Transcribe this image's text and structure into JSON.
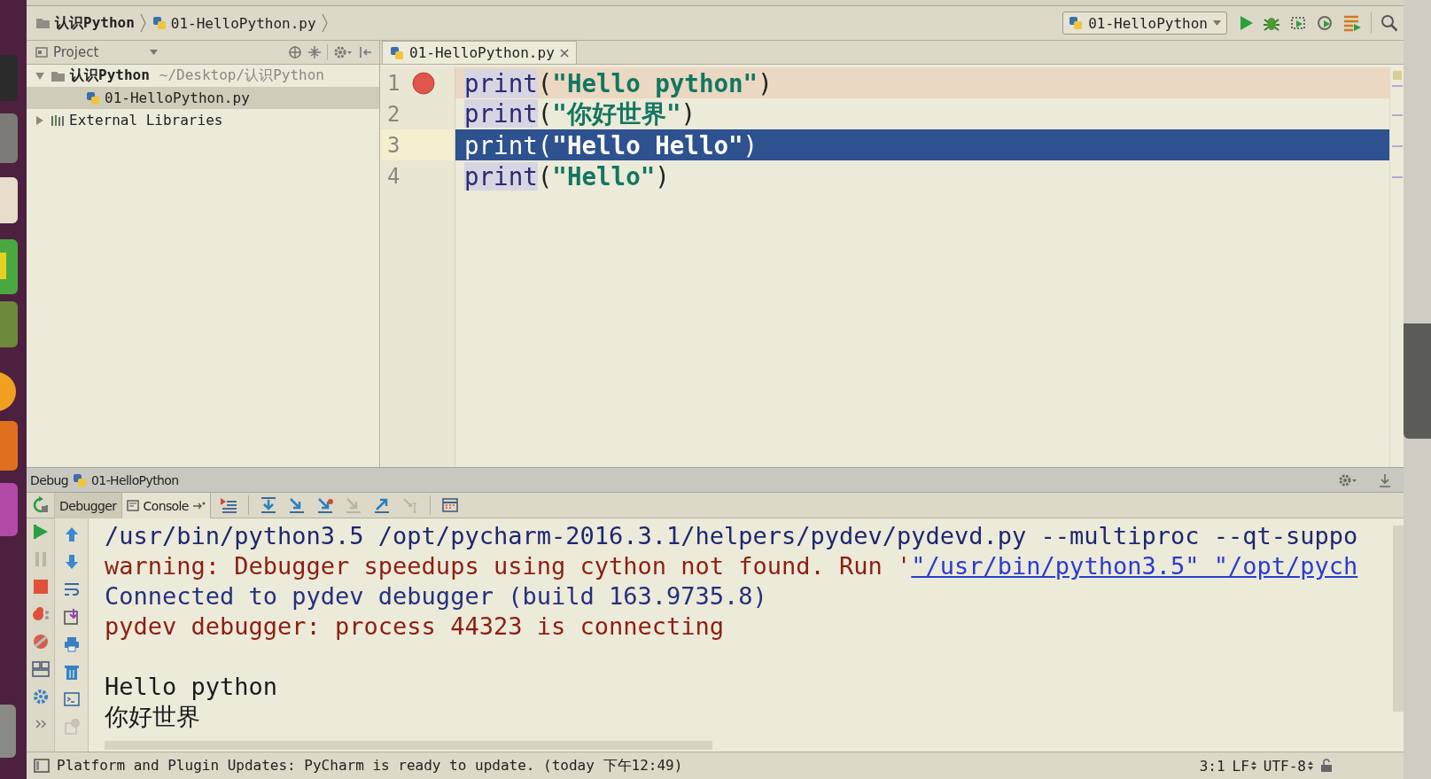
{
  "breadcrumb": [
    {
      "kind": "folder",
      "label": "认识Python"
    },
    {
      "kind": "file",
      "label": "01-HelloPython.py"
    }
  ],
  "run_config": {
    "label": "01-HelloPython"
  },
  "project": {
    "title": "Project",
    "tree": [
      {
        "kind": "folder",
        "label": "认识Python",
        "path": "~/Desktop/认识Python",
        "expanded": true,
        "selected": false,
        "children": [
          {
            "kind": "file",
            "label": "01-HelloPython.py",
            "selected": true
          }
        ]
      },
      {
        "kind": "library",
        "label": "External Libraries",
        "expanded": false,
        "selected": false
      }
    ]
  },
  "editor": {
    "tabs": [
      {
        "label": "01-HelloPython.py",
        "selected": true
      }
    ],
    "lines": [
      {
        "number": "1",
        "breakpoint": true,
        "selected": false,
        "tokens": [
          {
            "kind": "builtin",
            "text": "print"
          },
          {
            "kind": "punct",
            "text": "("
          },
          {
            "kind": "string",
            "text": "\"Hello python\""
          },
          {
            "kind": "punct",
            "text": ")"
          }
        ]
      },
      {
        "number": "2",
        "breakpoint": false,
        "selected": false,
        "tokens": [
          {
            "kind": "builtin",
            "text": "print"
          },
          {
            "kind": "punct",
            "text": "("
          },
          {
            "kind": "string",
            "text": "\"你好世界\""
          },
          {
            "kind": "punct",
            "text": ")"
          }
        ]
      },
      {
        "number": "3",
        "breakpoint": false,
        "selected": true,
        "tokens": [
          {
            "kind": "builtin",
            "text": "print"
          },
          {
            "kind": "punct",
            "text": "("
          },
          {
            "kind": "string",
            "text": "\"Hello Hello\""
          },
          {
            "kind": "punct",
            "text": ")"
          }
        ]
      },
      {
        "number": "4",
        "breakpoint": false,
        "selected": false,
        "tokens": [
          {
            "kind": "builtin",
            "text": "print"
          },
          {
            "kind": "punct",
            "text": "("
          },
          {
            "kind": "string",
            "text": "\"Hello\""
          },
          {
            "kind": "punct",
            "text": ")"
          }
        ]
      }
    ]
  },
  "debug": {
    "title": "Debug",
    "config": "01-HelloPython",
    "tabs": [
      {
        "label": "Debugger",
        "selected": false
      },
      {
        "label": "Console",
        "selected": true
      }
    ],
    "console": [
      {
        "kind": "command",
        "text": "/usr/bin/python3.5 /opt/pycharm-2016.3.1/helpers/pydev/pydevd.py --multiproc --qt-suppo"
      },
      {
        "kind": "warning",
        "text": "warning: Debugger speedups using cython not found. Run '",
        "link": "\"/usr/bin/python3.5\" \"/opt/pych"
      },
      {
        "kind": "info",
        "text": "Connected to pydev debugger (build 163.9735.8)"
      },
      {
        "kind": "error",
        "text": "pydev debugger: process 44323 is connecting"
      },
      {
        "kind": "blank"
      },
      {
        "kind": "output",
        "text": "Hello python"
      },
      {
        "kind": "output",
        "text": "你好世界"
      }
    ]
  },
  "status_bar": {
    "message": "Platform and Plugin Updates: PyCharm is ready to update. (today 下午12:49)",
    "position": "3:1",
    "line_separator": "LF",
    "encoding": "UTF-8"
  }
}
